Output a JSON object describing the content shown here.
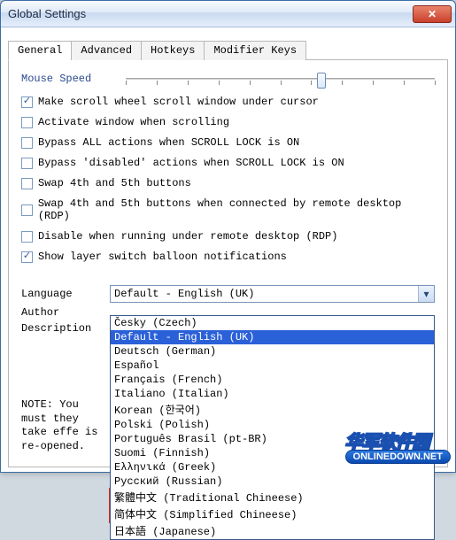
{
  "window": {
    "title": "Global Settings"
  },
  "tabs": [
    "General",
    "Advanced",
    "Hotkeys",
    "Modifier Keys"
  ],
  "general": {
    "mouse_speed_label": "Mouse Speed",
    "checkboxes": [
      {
        "label": "Make scroll wheel scroll window under cursor",
        "checked": true
      },
      {
        "label": "Activate window when scrolling",
        "checked": false
      },
      {
        "label": "Bypass ALL actions when SCROLL LOCK is ON",
        "checked": false
      },
      {
        "label": "Bypass 'disabled' actions when SCROLL LOCK is ON",
        "checked": false
      },
      {
        "label": "Swap 4th and 5th buttons",
        "checked": false
      },
      {
        "label": "Swap 4th and 5th buttons when connected by remote desktop (RDP)",
        "checked": false
      },
      {
        "label": "Disable when running under remote desktop (RDP)",
        "checked": false
      },
      {
        "label": "Show layer switch balloon notifications",
        "checked": true
      }
    ],
    "language_label": "Language",
    "language_value": "Default - English (UK)",
    "author_label": "Author",
    "description_label": "Description",
    "note": "NOTE: You must\nthey take effe\nis re-opened."
  },
  "language_options": [
    "Česky (Czech)",
    "Default - English (UK)",
    "Deutsch (German)",
    "Español",
    "Français (French)",
    "Italiano (Italian)",
    "Korean (한국어)",
    "Polski (Polish)",
    "Português Brasil (pt-BR)",
    "Suomi (Finnish)",
    "Ελληνικά (Greek)",
    "Русский (Russian)",
    "繁體中文 (Traditional Chineese)",
    "简体中文 (Simplified Chineese)",
    "日本語 (Japanese)"
  ],
  "language_selected_index": 1,
  "highlight_indices": [
    12,
    13
  ],
  "watermark": {
    "main": "华军软件园",
    "sub": "ONLINEDOWN.NET"
  }
}
